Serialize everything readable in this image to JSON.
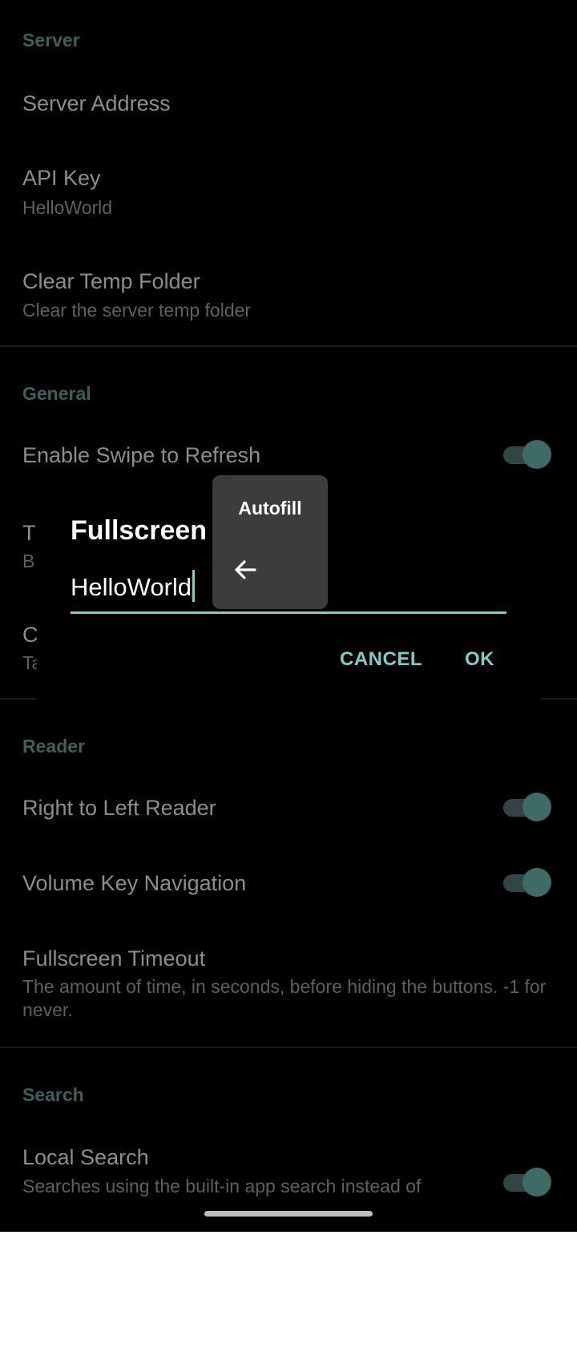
{
  "settings": {
    "server_header": "Server",
    "server_address_title": "Server Address",
    "api_key_title": "API Key",
    "api_key_value": "HelloWorld",
    "clear_temp_title": "Clear Temp Folder",
    "clear_temp_summary": "Clear the server temp folder",
    "general_header": "General",
    "swipe_refresh_title": "Enable Swipe to Refresh",
    "partial_item1_title": "T",
    "partial_item1_summary": "B",
    "partial_item2_title": "C",
    "partial_item2_summary": "Ta",
    "reader_header": "Reader",
    "rtl_reader_title": "Right to Left Reader",
    "volume_key_title": "Volume Key Navigation",
    "fullscreen_timeout_title": "Fullscreen Timeout",
    "fullscreen_timeout_summary": "The amount of time, in seconds, before hiding the buttons. -1 for never.",
    "search_header": "Search",
    "local_search_title": "Local Search",
    "local_search_summary": "Searches using the built-in app search instead of"
  },
  "toggles": {
    "swipe_refresh": true,
    "rtl_reader": true,
    "volume_key": true,
    "local_search": true
  },
  "dialog": {
    "title": "Fullscreen T",
    "input_value": "HelloWorld",
    "cancel_label": "CANCEL",
    "ok_label": "OK"
  },
  "autofill": {
    "label": "Autofill",
    "icon": "arrow-left-icon"
  },
  "colors": {
    "accent": "#80cbc4",
    "section_header": "#3e5f5c",
    "background": "#000000",
    "popup": "#3c3c3c"
  }
}
